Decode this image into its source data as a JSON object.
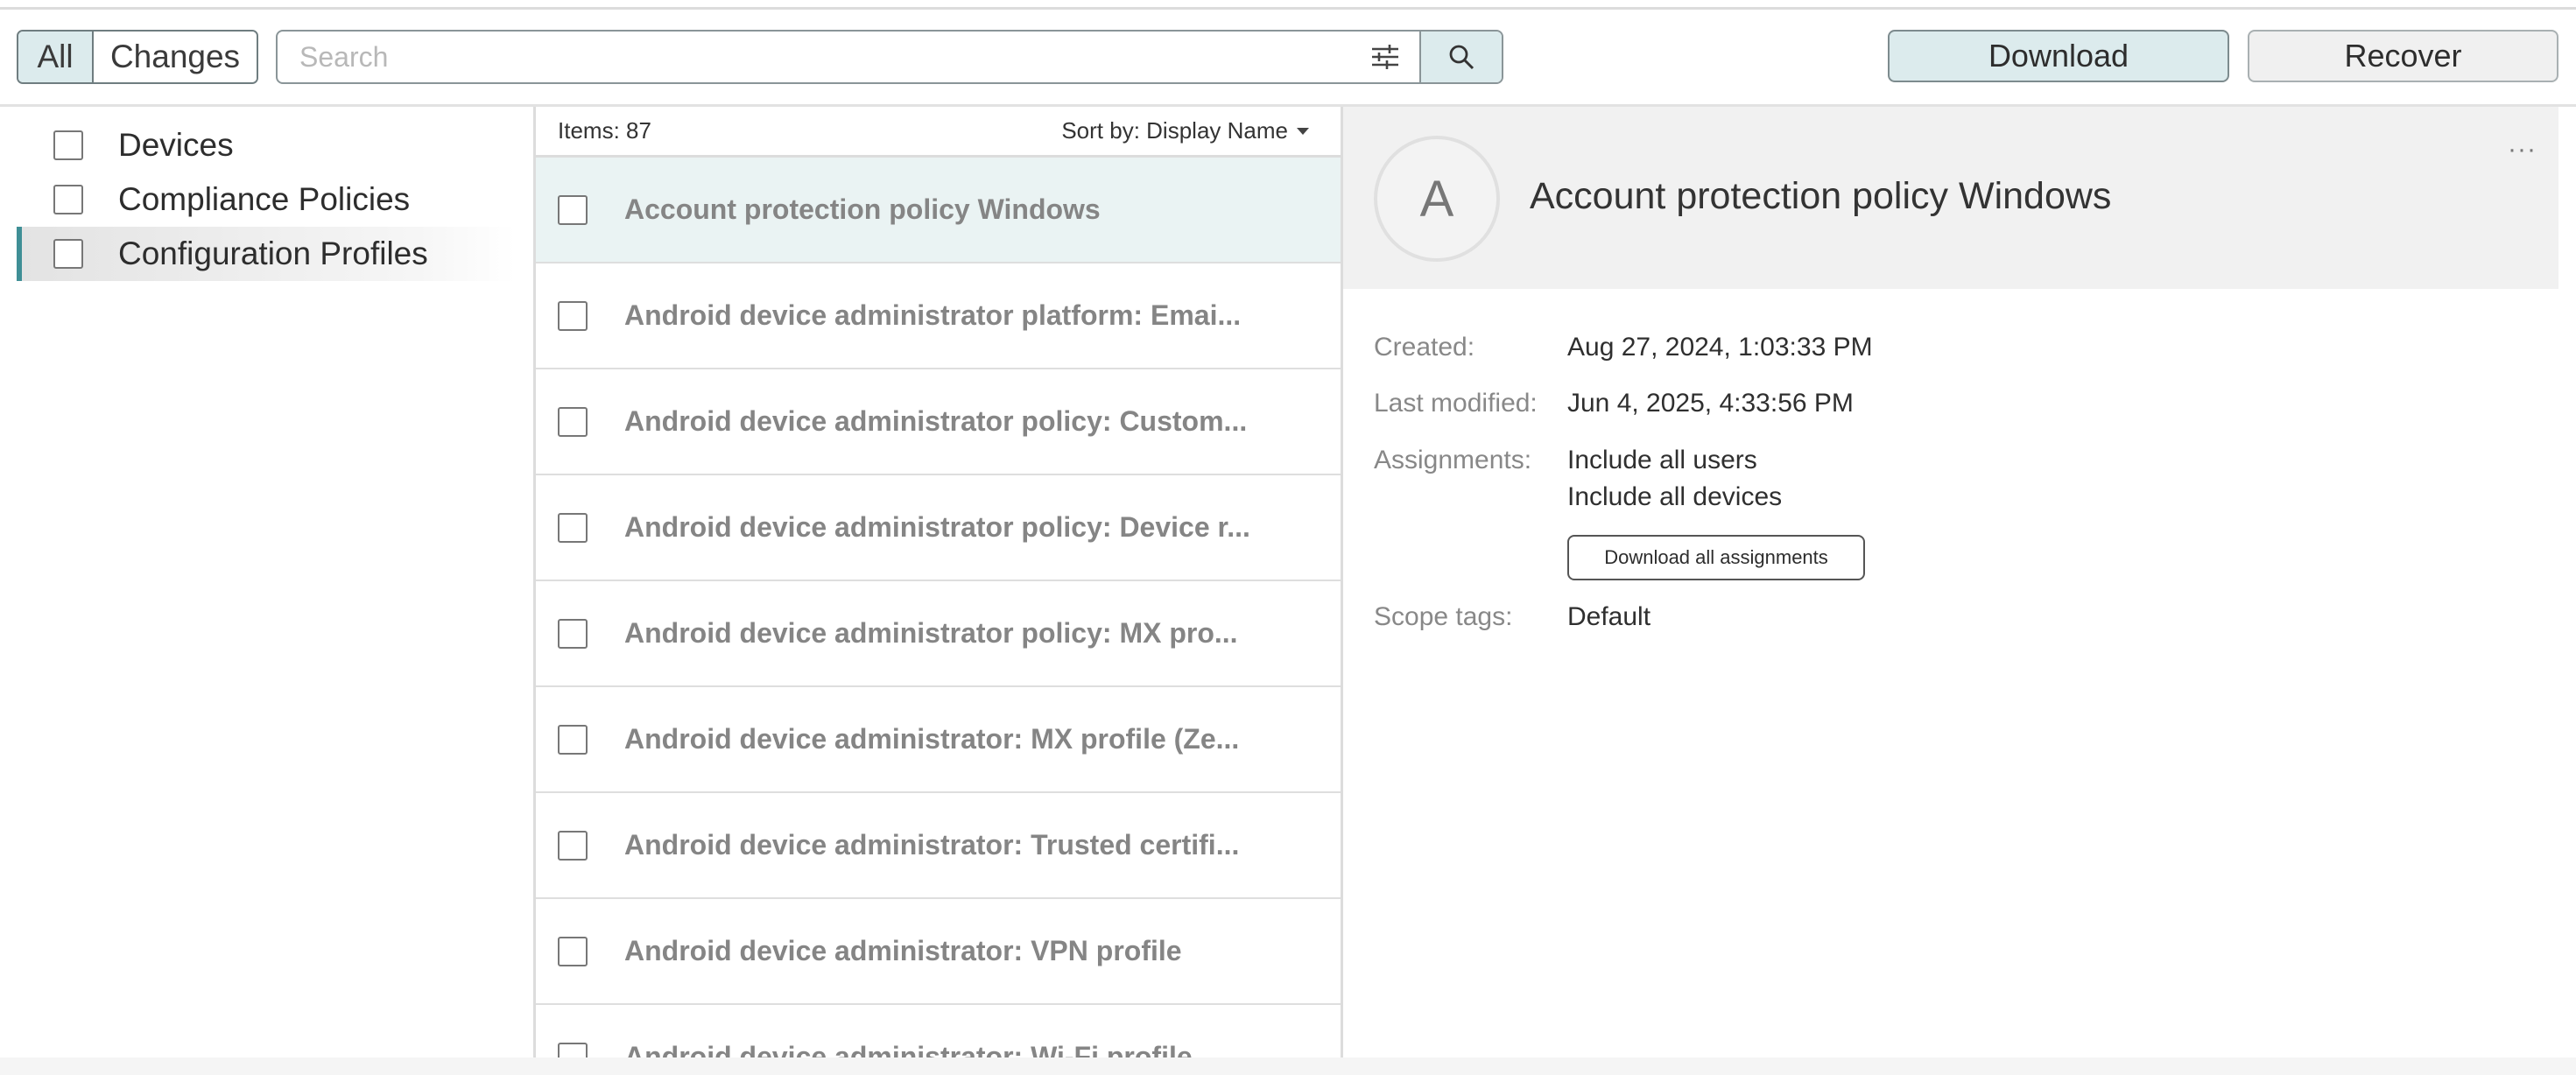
{
  "toolbar": {
    "all_label": "All",
    "changes_label": "Changes",
    "search_placeholder": "Search",
    "download_label": "Download",
    "recover_label": "Recover"
  },
  "icons": {
    "filter": "sliders-icon",
    "search": "magnifier-icon",
    "more": "ellipsis-icon"
  },
  "colors": {
    "accent": "#3f8f96",
    "selected_bg": "#dcebed"
  },
  "tree": {
    "items": [
      {
        "label": "Devices"
      },
      {
        "label": "Compliance Policies"
      },
      {
        "label": "Configuration Profiles"
      }
    ]
  },
  "list": {
    "items_count": "Items: 87",
    "sort_label": "Sort by: Display Name",
    "rows": [
      "Account protection policy Windows",
      "Android device administrator platform: Emai...",
      "Android device administrator policy: Custom...",
      "Android device administrator policy: Device r...",
      "Android device administrator policy: MX pro...",
      "Android device administrator: MX profile (Ze...",
      "Android device administrator: Trusted certifi...",
      "Android device administrator: VPN profile",
      "Android device administrator: Wi-Fi profile"
    ]
  },
  "detail": {
    "avatar_letter": "A",
    "title": "Account protection policy Windows",
    "more": "···",
    "created_label": "Created:",
    "created_value": "Aug 27, 2024, 1:03:33 PM",
    "modified_label": "Last modified:",
    "modified_value": "Jun 4, 2025, 4:33:56 PM",
    "assignments_label": "Assignments:",
    "assignments": [
      "Include all users",
      "Include all devices"
    ],
    "download_assignments_label": "Download all assignments",
    "scope_label": "Scope tags:",
    "scope_value": "Default"
  }
}
